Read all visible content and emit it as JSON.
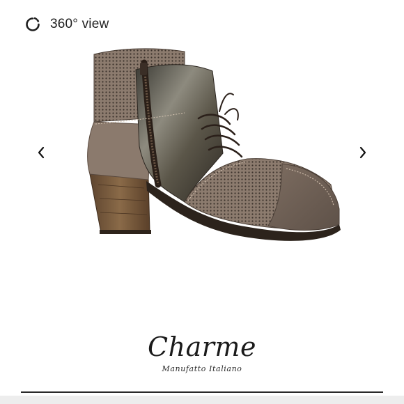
{
  "viewer": {
    "view360_label": "360° view",
    "view360_icon": "rotate-360-icon",
    "prev_icon": "chevron-left-icon",
    "next_icon": "chevron-right-icon"
  },
  "product": {
    "image": "ankle-boot-lace-up-brogue-taupe"
  },
  "brand": {
    "name": "Charme",
    "subtitle": "Manufatto Italiano"
  },
  "colors": {
    "background": "#ffffff",
    "text": "#1f1f1f",
    "leather_dark": "#4a3f37",
    "leather_light": "#8b7a6d",
    "heel_wood": "#7a5a3c"
  }
}
